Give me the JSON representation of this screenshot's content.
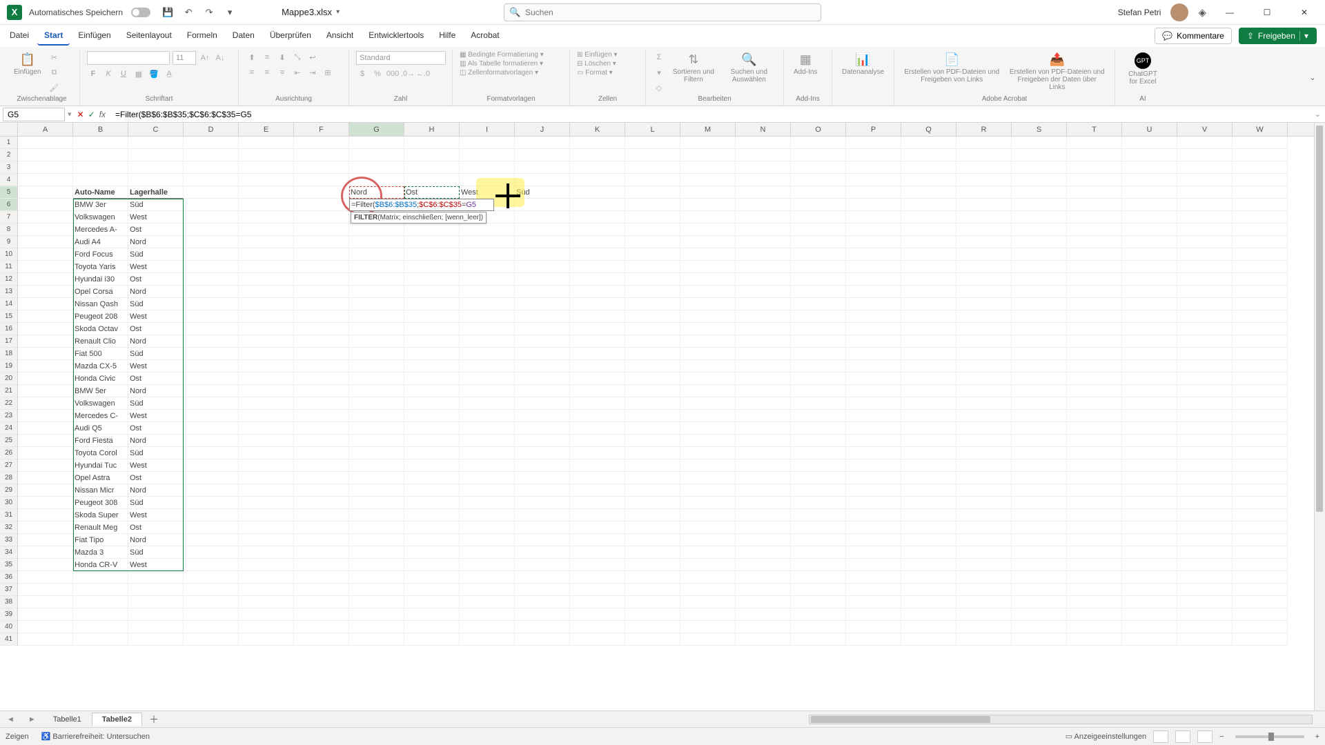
{
  "titlebar": {
    "autosave_label": "Automatisches Speichern",
    "filename": "Mappe3.xlsx",
    "search_placeholder": "Suchen",
    "username": "Stefan Petri"
  },
  "tabs": {
    "items": [
      "Datei",
      "Start",
      "Einfügen",
      "Seitenlayout",
      "Formeln",
      "Daten",
      "Überprüfen",
      "Ansicht",
      "Entwicklertools",
      "Hilfe",
      "Acrobat"
    ],
    "active_index": 1,
    "comments": "Kommentare",
    "share": "Freigeben"
  },
  "ribbon": {
    "groups": {
      "clipboard": {
        "paste": "Einfügen",
        "label": "Zwischenablage"
      },
      "font": {
        "label": "Schriftart",
        "size": "11"
      },
      "alignment": {
        "label": "Ausrichtung"
      },
      "number": {
        "label": "Zahl",
        "format": "Standard"
      },
      "styles": {
        "cond": "Bedingte Formatierung",
        "table": "Als Tabelle formatieren",
        "cell": "Zellenformatvorlagen",
        "label": "Formatvorlagen"
      },
      "cells": {
        "insert": "Einfügen",
        "delete": "Löschen",
        "format": "Format",
        "label": "Zellen"
      },
      "editing": {
        "sort": "Sortieren und Filtern",
        "find": "Suchen und Auswählen",
        "label": "Bearbeiten"
      },
      "addins": {
        "addins": "Add-Ins",
        "label": "Add-Ins"
      },
      "data": {
        "analysis": "Datenanalyse"
      },
      "acrobat": {
        "create": "Erstellen von PDF-Dateien und Freigeben von Links",
        "share": "Erstellen von PDF-Dateien und Freigeben der Daten über Links",
        "label": "Adobe Acrobat"
      },
      "ai": {
        "gpt": "ChatGPT for Excel",
        "label": "AI"
      }
    }
  },
  "fx": {
    "namebox": "G5",
    "formula": "=Filter($B$6:$B$35;$C$6:$C$35=G5"
  },
  "columns": [
    "A",
    "B",
    "C",
    "D",
    "E",
    "F",
    "G",
    "H",
    "I",
    "J",
    "K",
    "L",
    "M",
    "N",
    "O",
    "P",
    "Q",
    "R",
    "S",
    "T",
    "U",
    "V",
    "W"
  ],
  "active_col_index": 6,
  "headers_row5": {
    "G": "Nord",
    "H": "Ost",
    "I": "West",
    "J": "Süd"
  },
  "table": {
    "header": {
      "B": "Auto-Name",
      "C": "Lagerhalle"
    },
    "rows": [
      {
        "b": "BMW 3er",
        "c": "Süd"
      },
      {
        "b": "Volkswagen",
        "c": "West"
      },
      {
        "b": "Mercedes A-",
        "c": "Ost"
      },
      {
        "b": "Audi A4",
        "c": "Nord"
      },
      {
        "b": "Ford Focus",
        "c": "Süd"
      },
      {
        "b": "Toyota Yaris",
        "c": "West"
      },
      {
        "b": "Hyundai i30",
        "c": "Ost"
      },
      {
        "b": "Opel Corsa",
        "c": "Nord"
      },
      {
        "b": "Nissan Qash",
        "c": "Süd"
      },
      {
        "b": "Peugeot 208",
        "c": "West"
      },
      {
        "b": "Skoda Octav",
        "c": "Ost"
      },
      {
        "b": "Renault Clio",
        "c": "Nord"
      },
      {
        "b": "Fiat 500",
        "c": "Süd"
      },
      {
        "b": "Mazda CX-5",
        "c": "West"
      },
      {
        "b": "Honda Civic",
        "c": "Ost"
      },
      {
        "b": "BMW 5er",
        "c": "Nord"
      },
      {
        "b": "Volkswagen",
        "c": "Süd"
      },
      {
        "b": "Mercedes C-",
        "c": "West"
      },
      {
        "b": "Audi Q5",
        "c": "Ost"
      },
      {
        "b": "Ford Fiesta",
        "c": "Nord"
      },
      {
        "b": "Toyota Corol",
        "c": "Süd"
      },
      {
        "b": "Hyundai Tuc",
        "c": "West"
      },
      {
        "b": "Opel Astra",
        "c": "Ost"
      },
      {
        "b": "Nissan Micr",
        "c": "Nord"
      },
      {
        "b": "Peugeot 308",
        "c": "Süd"
      },
      {
        "b": "Skoda Super",
        "c": "West"
      },
      {
        "b": "Renault Meg",
        "c": "Ost"
      },
      {
        "b": "Fiat Tipo",
        "c": "Nord"
      },
      {
        "b": "Mazda 3",
        "c": "Süd"
      },
      {
        "b": "Honda CR-V",
        "c": "West"
      }
    ]
  },
  "edit_overlay": {
    "text_before": "=Filter(",
    "range1": "$B$6:$B$35",
    "sep1": ";",
    "range2": "$C$6:$C$35",
    "sep2": "=",
    "ref": "G5",
    "tooltip_fn": "FILTER",
    "tooltip_args": "(Matrix; einschließen; [wenn_leer])"
  },
  "sheets": {
    "items": [
      "Tabelle1",
      "Tabelle2"
    ],
    "active_index": 1
  },
  "status": {
    "mode": "Zeigen",
    "access": "Barrierefreiheit: Untersuchen",
    "display": "Anzeigeeinstellungen",
    "zoom_minus": "−",
    "zoom_plus": "+"
  }
}
